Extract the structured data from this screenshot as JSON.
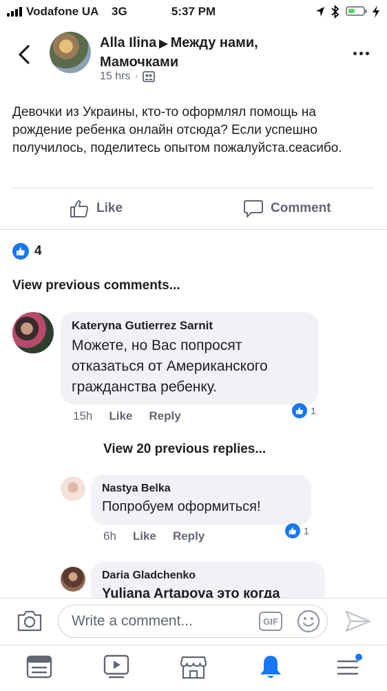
{
  "status_bar": {
    "carrier": "Vodafone UA",
    "network": "3G",
    "time": "5:37 PM"
  },
  "header": {
    "author": "Alla Ilina",
    "separator": "▶",
    "group": "Между нами, Мамочками",
    "time": "15 hrs",
    "dot": "·"
  },
  "post": {
    "text": "Девочки из Украины, кто-то оформлял помощь на рождение ребенка онлайн отсюда? Если успешно получилось, поделитесь опытом пожалуйста.сеасибо."
  },
  "actions": {
    "like_label": "Like",
    "comment_label": "Comment"
  },
  "reactions": {
    "count": "4"
  },
  "comments": {
    "view_previous": "View previous comments...",
    "items": [
      {
        "name": "Kateryna Gutierrez Sarnit",
        "text": "Можете, но Вас попросят отказаться от Американского гражданства ребенку.",
        "time": "15h",
        "like": "Like",
        "reply": "Reply",
        "reactions": "1"
      }
    ],
    "view_replies": "View 20 previous replies...",
    "replies": [
      {
        "name": "Nastya Belka",
        "text": "Попробуем оформиться!",
        "time": "6h",
        "like": "Like",
        "reply": "Reply",
        "reactions": "1"
      },
      {
        "name": "Daria Gladchenko",
        "text": "Yuliana Artapova это когда"
      }
    ]
  },
  "composer": {
    "placeholder": "Write a comment...",
    "gif_label": "GIF"
  },
  "colors": {
    "accent": "#1877f2",
    "muted": "#606770",
    "bubble": "#f0f2f5"
  }
}
